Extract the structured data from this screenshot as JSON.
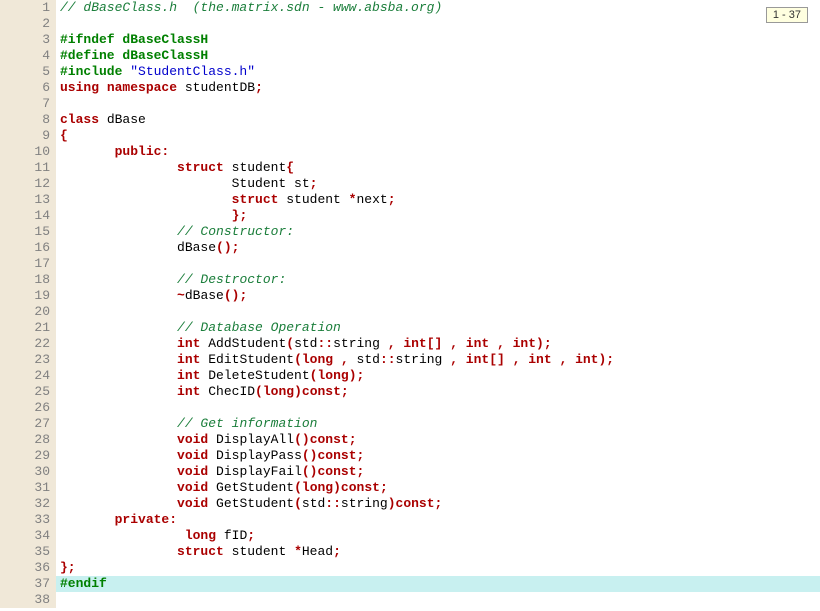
{
  "indicator": "1 - 37",
  "highlight_line": 37,
  "lines": [
    {
      "n": 1,
      "tokens": [
        [
          "comment",
          "// dBaseClass.h  (the.matrix.sdn - www.absba.org)"
        ]
      ]
    },
    {
      "n": 2,
      "tokens": []
    },
    {
      "n": 3,
      "tokens": [
        [
          "preproc",
          "#ifndef dBaseClassH"
        ]
      ]
    },
    {
      "n": 4,
      "tokens": [
        [
          "preproc",
          "#define dBaseClassH"
        ]
      ]
    },
    {
      "n": 5,
      "tokens": [
        [
          "preproc",
          "#include "
        ],
        [
          "string",
          "\"StudentClass.h\""
        ]
      ]
    },
    {
      "n": 6,
      "tokens": [
        [
          "keyword",
          "using"
        ],
        [
          "plain",
          " "
        ],
        [
          "keyword",
          "namespace"
        ],
        [
          "plain",
          " studentDB"
        ],
        [
          "punct",
          ";"
        ]
      ]
    },
    {
      "n": 7,
      "tokens": []
    },
    {
      "n": 8,
      "tokens": [
        [
          "keyword",
          "class"
        ],
        [
          "plain",
          " dBase"
        ]
      ]
    },
    {
      "n": 9,
      "tokens": [
        [
          "punct",
          "{"
        ]
      ]
    },
    {
      "n": 10,
      "tokens": [
        [
          "plain",
          "       "
        ],
        [
          "keyword",
          "public:"
        ]
      ]
    },
    {
      "n": 11,
      "tokens": [
        [
          "plain",
          "               "
        ],
        [
          "keyword",
          "struct"
        ],
        [
          "plain",
          " student"
        ],
        [
          "punct",
          "{"
        ]
      ]
    },
    {
      "n": 12,
      "tokens": [
        [
          "plain",
          "                      Student st"
        ],
        [
          "punct",
          ";"
        ]
      ]
    },
    {
      "n": 13,
      "tokens": [
        [
          "plain",
          "                      "
        ],
        [
          "keyword",
          "struct"
        ],
        [
          "plain",
          " student "
        ],
        [
          "punct",
          "*"
        ],
        [
          "plain",
          "next"
        ],
        [
          "punct",
          ";"
        ]
      ]
    },
    {
      "n": 14,
      "tokens": [
        [
          "plain",
          "                      "
        ],
        [
          "punct",
          "};"
        ]
      ]
    },
    {
      "n": 15,
      "tokens": [
        [
          "plain",
          "               "
        ],
        [
          "comment",
          "// Constructor:"
        ]
      ]
    },
    {
      "n": 16,
      "tokens": [
        [
          "plain",
          "               dBase"
        ],
        [
          "punct",
          "();"
        ]
      ]
    },
    {
      "n": 17,
      "tokens": []
    },
    {
      "n": 18,
      "tokens": [
        [
          "plain",
          "               "
        ],
        [
          "comment",
          "// Destroctor:"
        ]
      ]
    },
    {
      "n": 19,
      "tokens": [
        [
          "plain",
          "               "
        ],
        [
          "punct",
          "~"
        ],
        [
          "plain",
          "dBase"
        ],
        [
          "punct",
          "();"
        ]
      ]
    },
    {
      "n": 20,
      "tokens": []
    },
    {
      "n": 21,
      "tokens": [
        [
          "plain",
          "               "
        ],
        [
          "comment",
          "// Database Operation"
        ]
      ]
    },
    {
      "n": 22,
      "tokens": [
        [
          "plain",
          "               "
        ],
        [
          "keyword",
          "int"
        ],
        [
          "plain",
          " AddStudent"
        ],
        [
          "punct",
          "("
        ],
        [
          "plain",
          "std"
        ],
        [
          "punct",
          "::"
        ],
        [
          "plain",
          "string "
        ],
        [
          "punct",
          ","
        ],
        [
          "plain",
          " "
        ],
        [
          "keyword",
          "int"
        ],
        [
          "punct",
          "[]"
        ],
        [
          "plain",
          " "
        ],
        [
          "punct",
          ","
        ],
        [
          "plain",
          " "
        ],
        [
          "keyword",
          "int"
        ],
        [
          "plain",
          " "
        ],
        [
          "punct",
          ","
        ],
        [
          "plain",
          " "
        ],
        [
          "keyword",
          "int"
        ],
        [
          "punct",
          ");"
        ]
      ]
    },
    {
      "n": 23,
      "tokens": [
        [
          "plain",
          "               "
        ],
        [
          "keyword",
          "int"
        ],
        [
          "plain",
          " EditStudent"
        ],
        [
          "punct",
          "("
        ],
        [
          "keyword",
          "long"
        ],
        [
          "plain",
          " "
        ],
        [
          "punct",
          ","
        ],
        [
          "plain",
          " std"
        ],
        [
          "punct",
          "::"
        ],
        [
          "plain",
          "string "
        ],
        [
          "punct",
          ","
        ],
        [
          "plain",
          " "
        ],
        [
          "keyword",
          "int"
        ],
        [
          "punct",
          "[]"
        ],
        [
          "plain",
          " "
        ],
        [
          "punct",
          ","
        ],
        [
          "plain",
          " "
        ],
        [
          "keyword",
          "int"
        ],
        [
          "plain",
          " "
        ],
        [
          "punct",
          ","
        ],
        [
          "plain",
          " "
        ],
        [
          "keyword",
          "int"
        ],
        [
          "punct",
          ");"
        ]
      ]
    },
    {
      "n": 24,
      "tokens": [
        [
          "plain",
          "               "
        ],
        [
          "keyword",
          "int"
        ],
        [
          "plain",
          " DeleteStudent"
        ],
        [
          "punct",
          "("
        ],
        [
          "keyword",
          "long"
        ],
        [
          "punct",
          ");"
        ]
      ]
    },
    {
      "n": 25,
      "tokens": [
        [
          "plain",
          "               "
        ],
        [
          "keyword",
          "int"
        ],
        [
          "plain",
          " ChecID"
        ],
        [
          "punct",
          "("
        ],
        [
          "keyword",
          "long"
        ],
        [
          "punct",
          ")"
        ],
        [
          "keyword",
          "const"
        ],
        [
          "punct",
          ";"
        ]
      ]
    },
    {
      "n": 26,
      "tokens": []
    },
    {
      "n": 27,
      "tokens": [
        [
          "plain",
          "               "
        ],
        [
          "comment",
          "// Get information"
        ]
      ]
    },
    {
      "n": 28,
      "tokens": [
        [
          "plain",
          "               "
        ],
        [
          "keyword",
          "void"
        ],
        [
          "plain",
          " DisplayAll"
        ],
        [
          "punct",
          "()"
        ],
        [
          "keyword",
          "const"
        ],
        [
          "punct",
          ";"
        ]
      ]
    },
    {
      "n": 29,
      "tokens": [
        [
          "plain",
          "               "
        ],
        [
          "keyword",
          "void"
        ],
        [
          "plain",
          " DisplayPass"
        ],
        [
          "punct",
          "()"
        ],
        [
          "keyword",
          "const"
        ],
        [
          "punct",
          ";"
        ]
      ]
    },
    {
      "n": 30,
      "tokens": [
        [
          "plain",
          "               "
        ],
        [
          "keyword",
          "void"
        ],
        [
          "plain",
          " DisplayFail"
        ],
        [
          "punct",
          "()"
        ],
        [
          "keyword",
          "const"
        ],
        [
          "punct",
          ";"
        ]
      ]
    },
    {
      "n": 31,
      "tokens": [
        [
          "plain",
          "               "
        ],
        [
          "keyword",
          "void"
        ],
        [
          "plain",
          " GetStudent"
        ],
        [
          "punct",
          "("
        ],
        [
          "keyword",
          "long"
        ],
        [
          "punct",
          ")"
        ],
        [
          "keyword",
          "const"
        ],
        [
          "punct",
          ";"
        ]
      ]
    },
    {
      "n": 32,
      "tokens": [
        [
          "plain",
          "               "
        ],
        [
          "keyword",
          "void"
        ],
        [
          "plain",
          " GetStudent"
        ],
        [
          "punct",
          "("
        ],
        [
          "plain",
          "std"
        ],
        [
          "punct",
          "::"
        ],
        [
          "plain",
          "string"
        ],
        [
          "punct",
          ")"
        ],
        [
          "keyword",
          "const"
        ],
        [
          "punct",
          ";"
        ]
      ]
    },
    {
      "n": 33,
      "tokens": [
        [
          "plain",
          "       "
        ],
        [
          "keyword",
          "private:"
        ]
      ]
    },
    {
      "n": 34,
      "tokens": [
        [
          "plain",
          "                "
        ],
        [
          "keyword",
          "long"
        ],
        [
          "plain",
          " fID"
        ],
        [
          "punct",
          ";"
        ]
      ]
    },
    {
      "n": 35,
      "tokens": [
        [
          "plain",
          "               "
        ],
        [
          "keyword",
          "struct"
        ],
        [
          "plain",
          " student "
        ],
        [
          "punct",
          "*"
        ],
        [
          "plain",
          "Head"
        ],
        [
          "punct",
          ";"
        ]
      ]
    },
    {
      "n": 36,
      "tokens": [
        [
          "punct",
          "};"
        ]
      ]
    },
    {
      "n": 37,
      "tokens": [
        [
          "preproc",
          "#endif"
        ]
      ]
    },
    {
      "n": 38,
      "tokens": []
    }
  ]
}
